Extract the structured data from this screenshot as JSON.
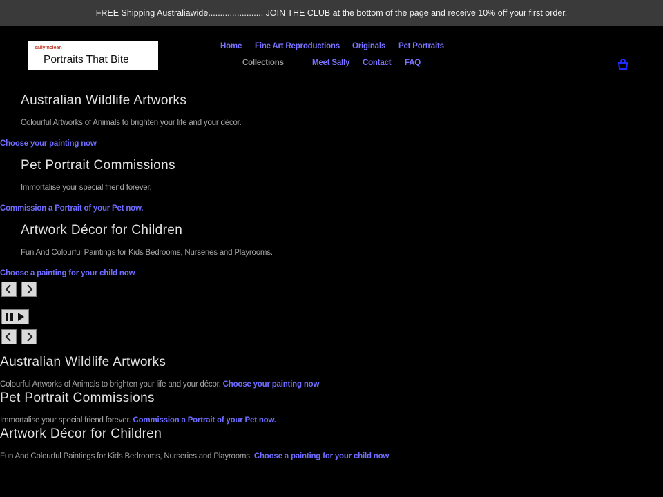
{
  "announcement": "FREE Shipping Australiawide....................... JOIN THE CLUB at the bottom of the page and receive 10% off your first order.",
  "logo": {
    "small_text": "sallymclean",
    "main_text": "Portraits That Bite"
  },
  "nav": {
    "row1": [
      "Home",
      "Fine Art Reproductions",
      "Originals",
      "Pet Portraits"
    ],
    "row2": [
      "Collections",
      "Meet Sally",
      "Contact",
      "FAQ"
    ]
  },
  "icons": {
    "cart": "bag-icon",
    "prev": "chevron-left-icon",
    "next": "chevron-right-icon",
    "pause": "pause-icon",
    "play": "play-icon"
  },
  "colors": {
    "link": "#6f6cff",
    "announce_bg": "#3a3a3a",
    "background": "#000000"
  },
  "slides": [
    {
      "title": "Australian Wildlife Artworks",
      "text": "Colourful Artworks of Animals to brighten your life and your décor.",
      "link": "Choose your painting now"
    },
    {
      "title": "Pet Portrait Commissions",
      "text": "Immortalise your special friend forever.",
      "link": "Commission a Portrait of your Pet now."
    },
    {
      "title": "Artwork Décor for Children",
      "text": "Fun And Colourful Paintings for Kids Bedrooms, Nurseries and Playrooms.",
      "link": "Choose a painting for your child now"
    }
  ]
}
